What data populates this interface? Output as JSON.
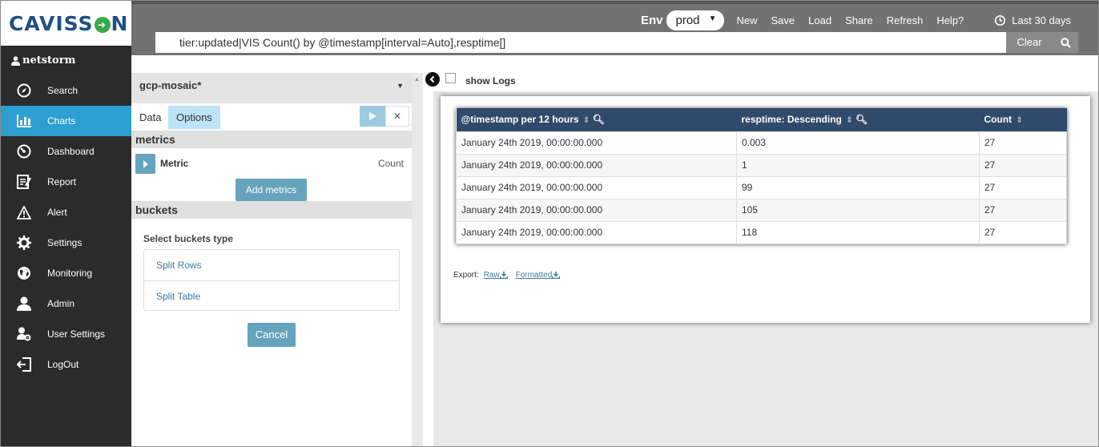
{
  "brand": {
    "name_prefix": "CAVISS",
    "name_suffix": "N",
    "accent": "#2d9fd0"
  },
  "user": {
    "name": "netstorm"
  },
  "nav": [
    {
      "label": "Search",
      "icon": "compass-icon"
    },
    {
      "label": "Charts",
      "icon": "bar-chart-icon",
      "active": true
    },
    {
      "label": "Dashboard",
      "icon": "dashboard-icon"
    },
    {
      "label": "Report",
      "icon": "report-icon"
    },
    {
      "label": "Alert",
      "icon": "alert-icon"
    },
    {
      "label": "Settings",
      "icon": "gear-icon"
    },
    {
      "label": "Monitoring",
      "icon": "globe-icon"
    },
    {
      "label": "Admin",
      "icon": "user-icon"
    },
    {
      "label": "User Settings",
      "icon": "user-settings-icon"
    },
    {
      "label": "LogOut",
      "icon": "logout-icon"
    }
  ],
  "topbar": {
    "env_label": "Env",
    "env_value": "prod",
    "menu": [
      "New",
      "Save",
      "Load",
      "Share",
      "Refresh",
      "Help?"
    ],
    "time_range": "Last 30 days",
    "query": "tier:updated|VIS Count() by @timestamp[interval=Auto],resptime[]",
    "clear_label": "Clear"
  },
  "editor": {
    "title": "gcp-mosaic*",
    "tabs": {
      "data": "Data",
      "options": "Options"
    },
    "metrics_title": "metrics",
    "metric_label": "Metric",
    "metric_value": "Count",
    "add_metrics_label": "Add metrics",
    "buckets_title": "buckets",
    "buckets_prompt": "Select buckets type",
    "bucket_options": [
      "Split Rows",
      "Split Table"
    ],
    "cancel_label": "Cancel"
  },
  "main": {
    "show_logs_label": "show Logs",
    "table": {
      "columns": [
        "@timestamp per 12 hours",
        "resptime: Descending",
        "Count"
      ],
      "rows": [
        [
          "January 24th 2019, 00:00:00.000",
          "0.003",
          "27"
        ],
        [
          "January 24th 2019, 00:00:00.000",
          "1",
          "27"
        ],
        [
          "January 24th 2019, 00:00:00.000",
          "99",
          "27"
        ],
        [
          "January 24th 2019, 00:00:00.000",
          "105",
          "27"
        ],
        [
          "January 24th 2019, 00:00:00.000",
          "118",
          "27"
        ]
      ]
    },
    "export_label": "Export:",
    "export_raw": "Raw",
    "export_formatted": "Formatted"
  }
}
